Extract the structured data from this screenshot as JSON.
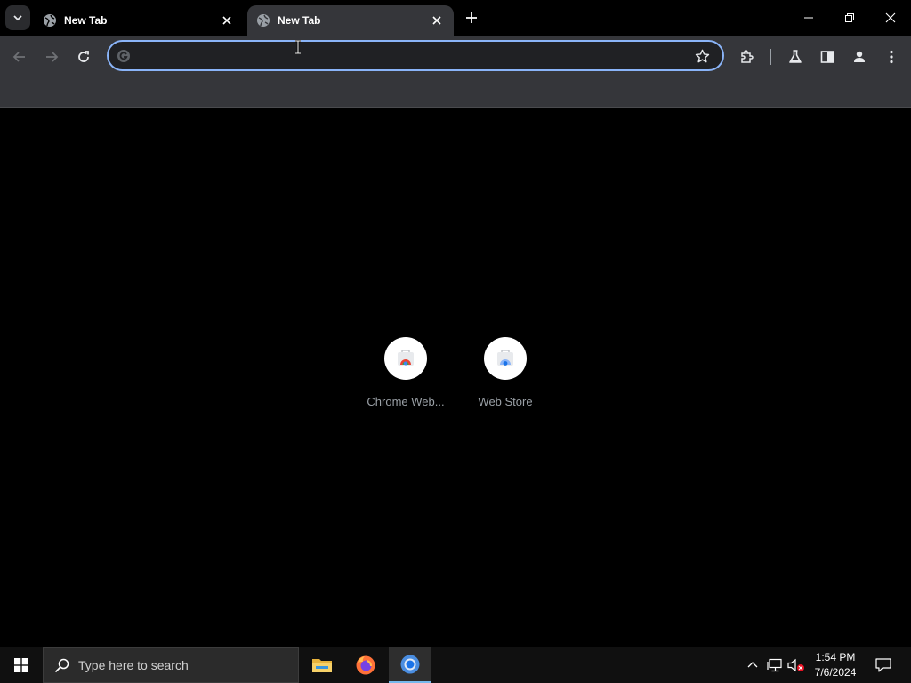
{
  "tabs": [
    {
      "title": "New Tab",
      "active": false
    },
    {
      "title": "New Tab",
      "active": true
    }
  ],
  "omnibox": {
    "value": "",
    "placeholder": ""
  },
  "shortcuts": [
    {
      "label": "Chrome Web..."
    },
    {
      "label": "Web Store"
    }
  ],
  "taskbar": {
    "search_placeholder": "Type here to search",
    "time": "1:54 PM",
    "date": "7/6/2024"
  },
  "colors": {
    "toolbar_bg": "#35363a",
    "omnibox_border": "#8ab4f8",
    "content_bg": "#000000",
    "taskbar_bg": "#101010"
  }
}
